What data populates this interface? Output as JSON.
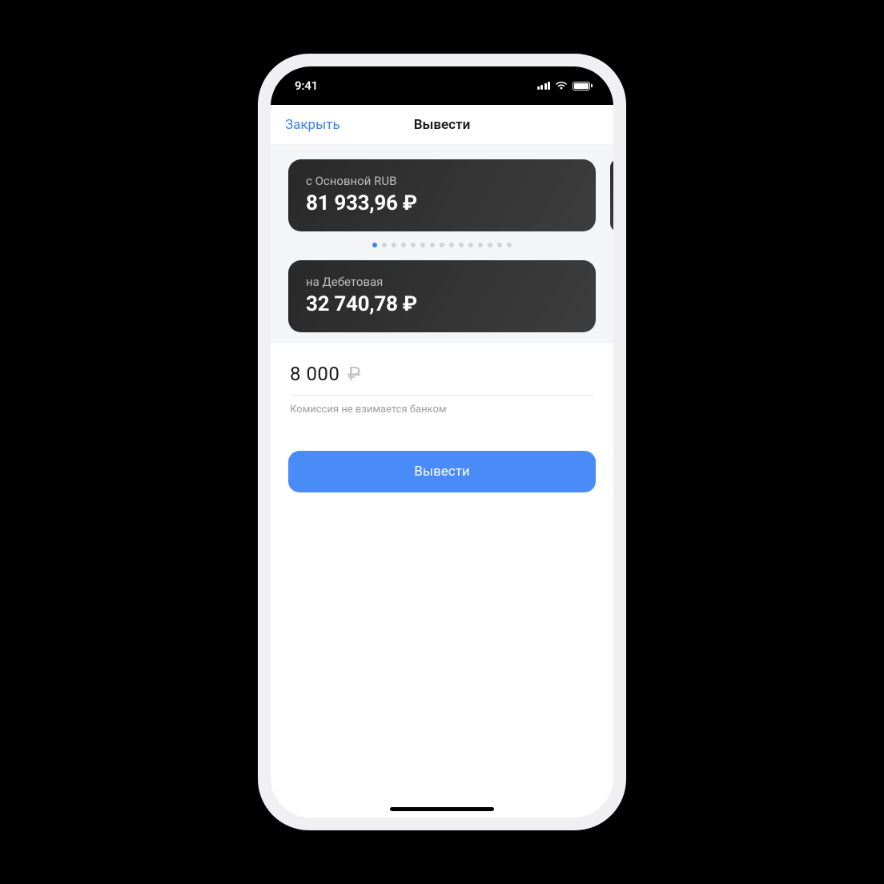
{
  "status": {
    "time": "9:41"
  },
  "nav": {
    "close_label": "Закрыть",
    "title": "Вывести"
  },
  "source_card": {
    "label": "с Основной RUB",
    "balance": "81 933,96 ₽"
  },
  "pager": {
    "count": 15,
    "active_index": 0
  },
  "dest_card": {
    "label": "на Дебетовая",
    "balance": "32 740,78 ₽"
  },
  "amount": {
    "value": "8 000",
    "currency_symbol": "₽"
  },
  "commission_text": "Комиссия не взимается банком",
  "withdraw_button_label": "Вывести"
}
